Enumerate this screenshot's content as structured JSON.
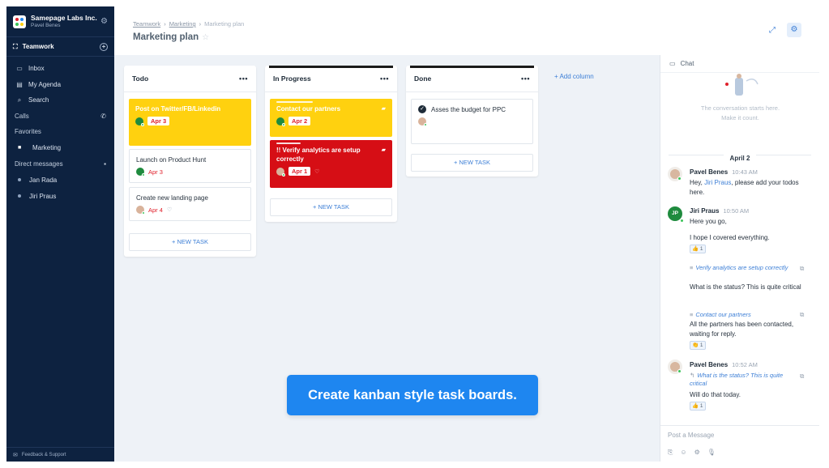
{
  "workspace": {
    "name": "Samepage Labs Inc.",
    "user": "Pavel Benes"
  },
  "sidebar": {
    "team_label": "Teamwork",
    "nav": [
      {
        "label": "Inbox",
        "icon": "inbox-icon"
      },
      {
        "label": "My Agenda",
        "icon": "agenda-icon"
      },
      {
        "label": "Search",
        "icon": "search-icon"
      }
    ],
    "calls_label": "Calls",
    "favorites_label": "Favorites",
    "favorites": [
      {
        "label": "Marketing"
      }
    ],
    "dm_label": "Direct messages",
    "dms": [
      {
        "label": "Jan Rada"
      },
      {
        "label": "Jiri Praus"
      }
    ],
    "feedback_label": "Feedback & Support"
  },
  "header": {
    "breadcrumb": [
      "Teamwork",
      "Marketing",
      "Marketing plan"
    ],
    "title": "Marketing plan"
  },
  "board": {
    "add_column_label": "+ Add column",
    "new_task_label": "+ NEW TASK",
    "columns": [
      {
        "title": "Todo",
        "cards": [
          {
            "title": "Post on Twitter/FB/Linkedin",
            "date": "Apr 3",
            "color": "#ffd10f"
          },
          {
            "title": "Launch on Product Hunt",
            "date": "Apr 3"
          },
          {
            "title": "Create new landing page",
            "date": "Apr 4"
          }
        ]
      },
      {
        "title": "In Progress",
        "cards": [
          {
            "title": "Contact our partners",
            "date": "Apr 2",
            "color": "#ffd10f"
          },
          {
            "title": "!! Verify analytics are setup correctly",
            "date": "Apr 1",
            "color": "#d60e15"
          }
        ]
      },
      {
        "title": "Done",
        "cards": [
          {
            "title": "Asses the budget for PPC"
          }
        ]
      }
    ]
  },
  "chat": {
    "title": "Chat",
    "empty_line1": "The conversation starts here.",
    "empty_line2": "Make it count.",
    "day": "April 2",
    "messages": [
      {
        "author": "Pavel Benes",
        "time": "10:43 AM",
        "text_pre": "Hey, ",
        "mention": "Jiri Praus",
        "text_post": ", please add your todos here."
      },
      {
        "author": "Jiri Praus",
        "initials": "JP",
        "time": "10:50 AM",
        "line1": "Here you go,",
        "line2": "I hope I covered everything.",
        "reaction": "👍 1"
      },
      {
        "task_ref": "Verify analytics are setup correctly",
        "text": "What is the status? This is quite critical"
      },
      {
        "task_ref": "Contact our partners",
        "text": "All the partners has been contacted, waiting for reply.",
        "reaction": "👏 1"
      },
      {
        "author": "Pavel Benes",
        "time": "10:52 AM",
        "quote": "What is the status? This is quite critical",
        "text": "Will do that today.",
        "reaction": "👍 1"
      }
    ],
    "input_placeholder": "Post a Message"
  },
  "banner": "Create kanban style task boards.",
  "colors": {
    "sidebar": "#0d2240",
    "accent": "#3d7fd6",
    "yellow": "#ffd10f",
    "red": "#d60e15",
    "banner": "#1e86f0"
  }
}
